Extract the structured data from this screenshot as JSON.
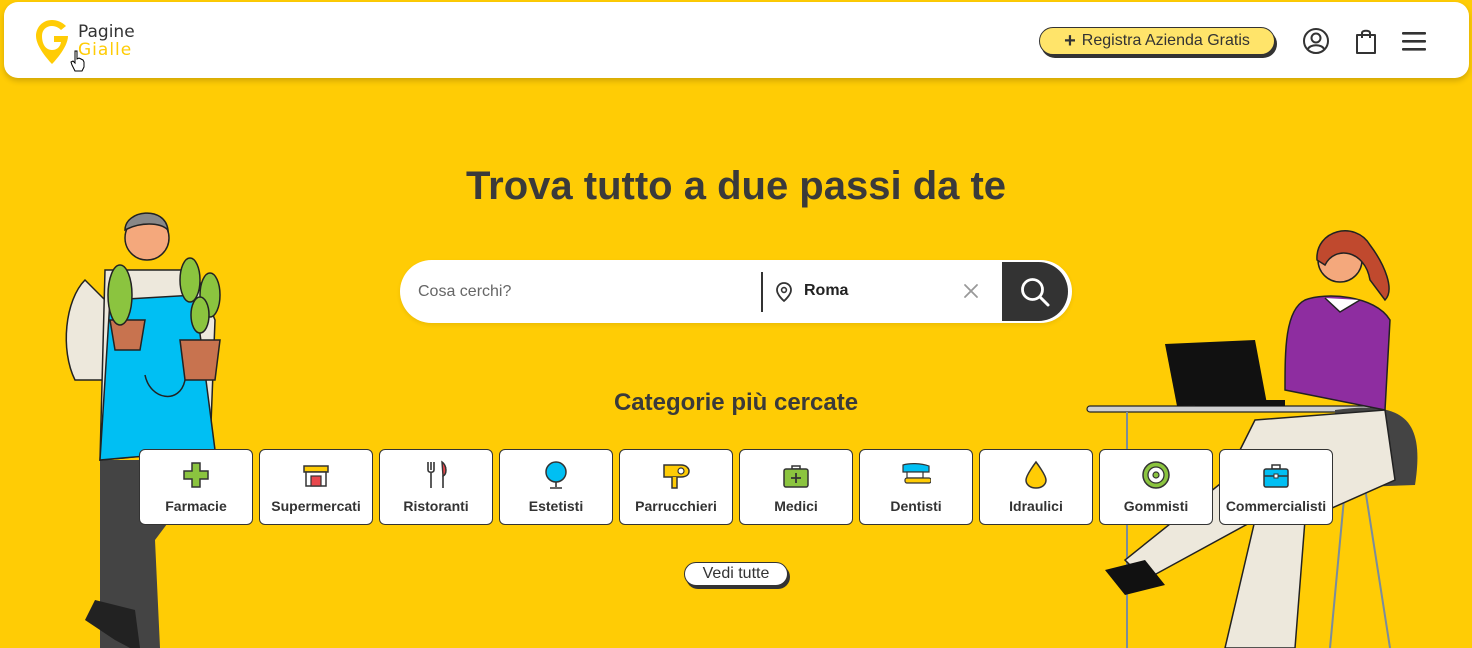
{
  "header": {
    "logo_line1": "Pagine",
    "logo_line2": "Gialle",
    "register_label": "Registra Azienda Gratis",
    "register_icon": "plus-icon",
    "icons": [
      "user-icon",
      "shopping-bag-icon",
      "menu-icon"
    ]
  },
  "hero": {
    "title": "Trova tutto a due passi da te"
  },
  "search": {
    "what_placeholder": "Cosa cerchi?",
    "what_value": "",
    "where_value": "Roma",
    "location_icon": "location-pin-icon",
    "clear_icon": "close-icon",
    "submit_icon": "search-icon"
  },
  "categories": {
    "title": "Categorie più cercate",
    "items": [
      {
        "label": "Farmacie",
        "icon": "pharmacy-cross-icon"
      },
      {
        "label": "Supermercati",
        "icon": "store-icon"
      },
      {
        "label": "Ristoranti",
        "icon": "fork-knife-icon"
      },
      {
        "label": "Estetisti",
        "icon": "mirror-icon"
      },
      {
        "label": "Parrucchieri",
        "icon": "hair-dryer-icon"
      },
      {
        "label": "Medici",
        "icon": "medical-bag-icon"
      },
      {
        "label": "Dentisti",
        "icon": "toothbrush-icon"
      },
      {
        "label": "Idraulici",
        "icon": "water-drop-icon"
      },
      {
        "label": "Gommisti",
        "icon": "tire-icon"
      },
      {
        "label": "Commercialisti",
        "icon": "briefcase-icon"
      }
    ],
    "see_all_label": "Vedi tutte"
  },
  "colors": {
    "brand_yellow": "#FFCC05",
    "dark": "#333333",
    "green": "#8BC43F",
    "blue": "#00BFF3",
    "red": "#E8474C"
  }
}
